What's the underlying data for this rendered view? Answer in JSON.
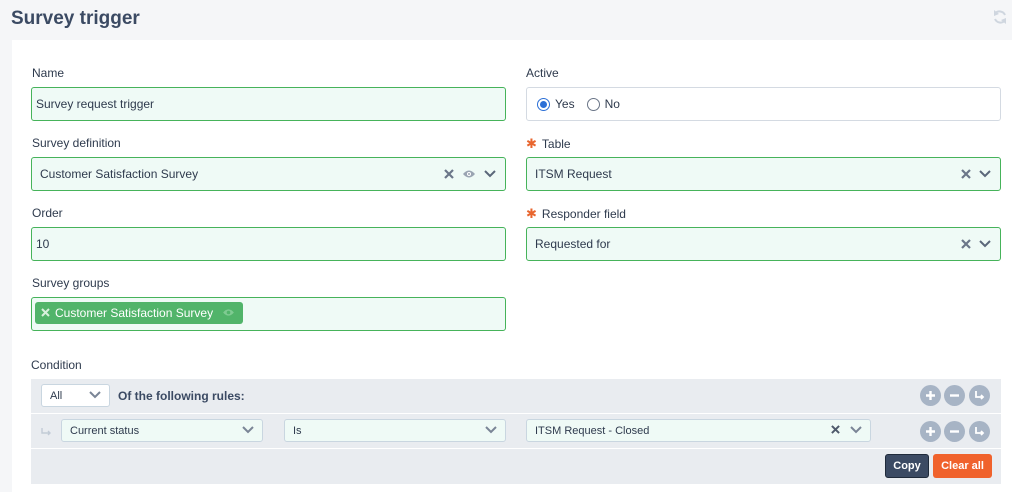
{
  "page": {
    "title": "Survey trigger"
  },
  "form": {
    "name": {
      "label": "Name",
      "value": "Survey request trigger"
    },
    "active": {
      "label": "Active",
      "options": [
        "Yes",
        "No"
      ],
      "selected": "Yes"
    },
    "survey_definition": {
      "label": "Survey definition",
      "value": "Customer Satisfaction Survey"
    },
    "table": {
      "label": "Table",
      "required_mark": "✱",
      "value": "ITSM Request"
    },
    "order": {
      "label": "Order",
      "value": "10"
    },
    "responder_field": {
      "label": "Responder field",
      "required_mark": "✱",
      "value": "Requested for"
    },
    "survey_groups": {
      "label": "Survey groups",
      "tags": [
        "Customer Satisfaction Survey"
      ]
    }
  },
  "condition": {
    "label": "Condition",
    "match_mode": "All",
    "following_text": "Of the following rules:",
    "rules": [
      {
        "field": "Current status",
        "operator": "Is",
        "value": "ITSM Request - Closed"
      }
    ],
    "copy_label": "Copy",
    "clear_label": "Clear all"
  },
  "colors": {
    "valid_border": "#46b35a",
    "valid_bg": "#effaf6",
    "tag_green": "#51b46a",
    "clear_orange": "#f0622c",
    "dark_navy": "#3b4a63"
  },
  "icons": [
    "refresh-icon",
    "clear-x-icon",
    "eye-icon",
    "chevron-down-icon",
    "plus-icon",
    "minus-icon",
    "sub-rule-arrow-icon"
  ]
}
